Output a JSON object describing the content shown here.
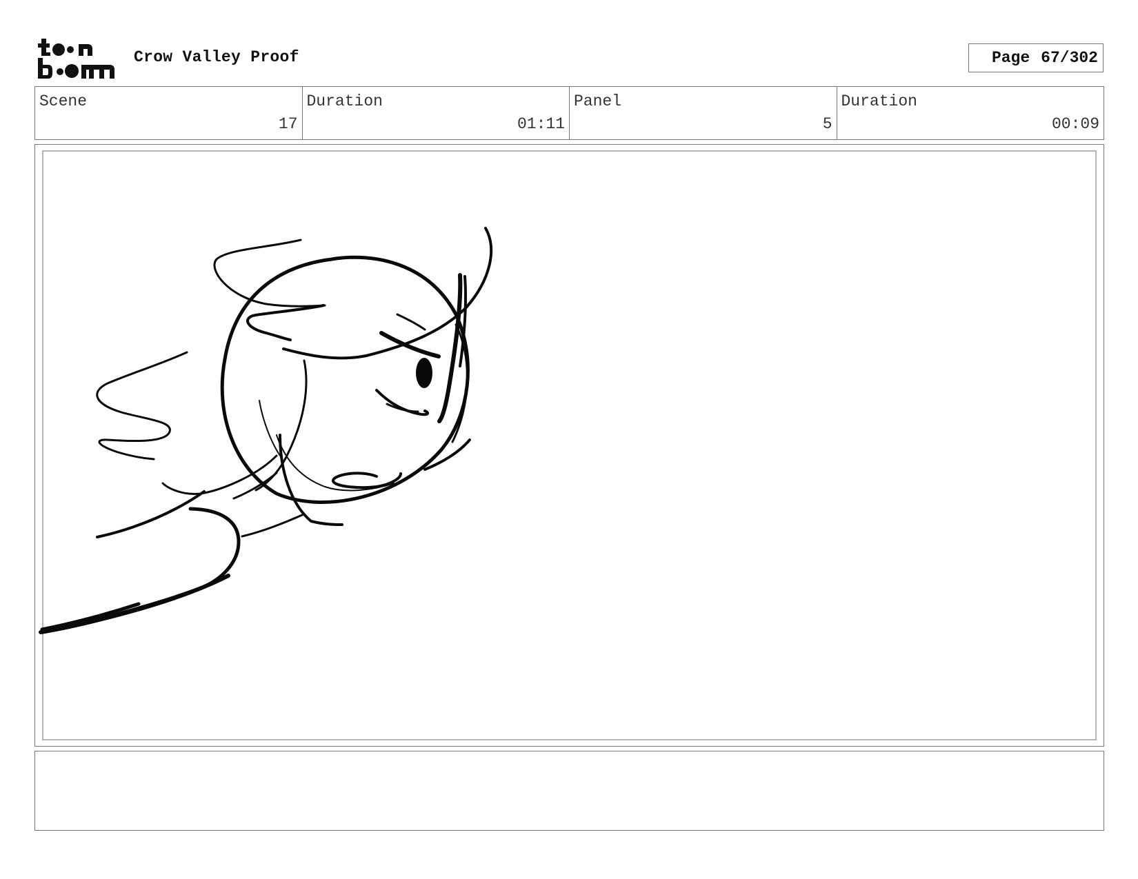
{
  "header": {
    "project_title": "Crow Valley Proof",
    "page_label": "Page",
    "page_value": "67/302"
  },
  "info": {
    "scene_label": "Scene",
    "scene_value": "17",
    "scene_duration_label": "Duration",
    "scene_duration_value": "01:11",
    "panel_label": "Panel",
    "panel_value": "5",
    "panel_duration_label": "Duration",
    "panel_duration_value": "00:09"
  },
  "notes": {
    "text": ""
  }
}
